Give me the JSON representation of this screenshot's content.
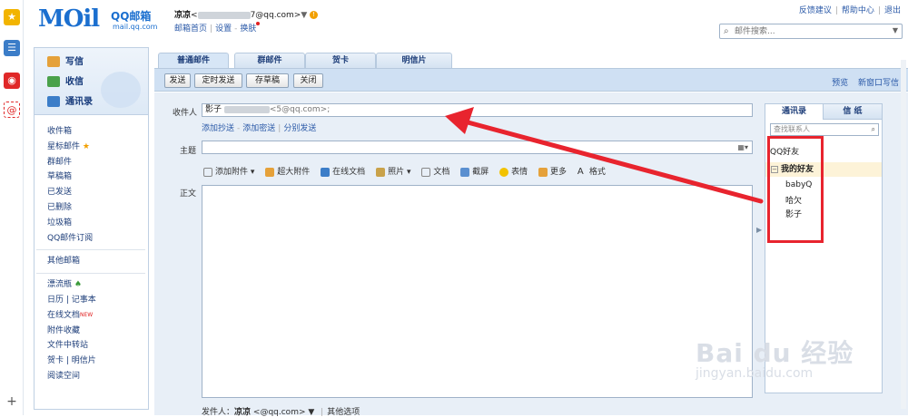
{
  "leftbar": {
    "plus_label": "+"
  },
  "header": {
    "logo_main": "MOil",
    "logo_sub": "QQ邮箱",
    "logo_url": "mail.qq.com",
    "user_name": "凉凉",
    "user_email_prefix": "<",
    "user_email_suffix": "7@qq.com>",
    "user_caret": "▼",
    "warn_glyph": "!",
    "links": [
      "邮箱首页",
      "设置",
      "换肤"
    ],
    "link_sep": "|",
    "top_links": [
      "反馈建议",
      "帮助中心",
      "退出"
    ],
    "search_placeholder": "邮件搜索..."
  },
  "nav": {
    "primary": [
      {
        "label": "写信",
        "color": "#e5a13a"
      },
      {
        "label": "收信",
        "color": "#4aa14a"
      },
      {
        "label": "通讯录",
        "color": "#3b7dc8"
      }
    ],
    "items": [
      {
        "label": "收件箱"
      },
      {
        "label": "星标邮件",
        "star": "★"
      },
      {
        "label": "群邮件"
      },
      {
        "label": "草稿箱"
      },
      {
        "label": "已发送"
      },
      {
        "label": "已删除"
      },
      {
        "label": "垃圾箱"
      },
      {
        "label": "QQ邮件订阅"
      }
    ],
    "other": "其他邮箱",
    "bottom": [
      {
        "label": "漂流瓶",
        "badge": "♠"
      },
      {
        "label": "日历 | 记事本"
      },
      {
        "label": "在线文档",
        "badge": "NEW"
      },
      {
        "label": "附件收藏"
      },
      {
        "label": "文件中转站"
      },
      {
        "label": "贺卡 | 明信片"
      },
      {
        "label": "阅读空间"
      }
    ]
  },
  "tabs": [
    "普通邮件",
    "群邮件",
    "贺卡",
    "明信片"
  ],
  "toolbar": {
    "buttons": [
      "发送",
      "定时发送",
      "存草稿",
      "关闭"
    ],
    "right_links": [
      "预览",
      "新窗口写信"
    ]
  },
  "compose": {
    "to_label": "收件人",
    "to_name": "影子",
    "to_email": "<5@qq.com>;",
    "to_links": [
      "添加抄送",
      "添加密送",
      "分别发送"
    ],
    "subject_label": "主题",
    "subject_value": "",
    "tools": [
      "添加附件",
      "超大附件",
      "在线文档",
      "照片",
      "文档",
      "截屏",
      "表情",
      "更多",
      "格式"
    ],
    "body_label": "正文",
    "sender_label": "发件人：",
    "sender_name": "凉凉",
    "sender_email": "<@qq.com>",
    "sender_caret": "▼",
    "other_options": "其他选项"
  },
  "right_panel": {
    "tabs": [
      "通讯录",
      "信 纸"
    ],
    "search_placeholder": "查找联系人",
    "group": "QQ好友",
    "subgroup": "我的好友",
    "contacts": [
      "babyQ",
      "哈欠",
      "影子"
    ]
  },
  "watermark": {
    "main": "Bai du 经验",
    "url": "jingyan.baidu.com"
  },
  "colors": {
    "accent": "#1b6fcf",
    "highlight": "#e8242e",
    "toolbar_bg": "#cfe0f3"
  }
}
